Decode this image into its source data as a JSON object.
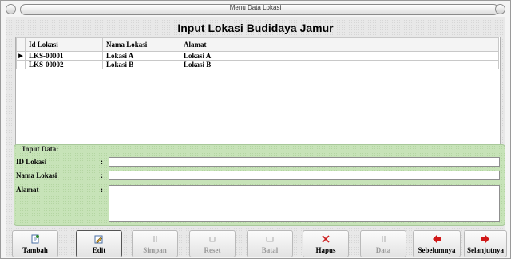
{
  "window": {
    "title": "Menu Data Lokasi"
  },
  "page": {
    "heading": "Input Lokasi Budidaya Jamur"
  },
  "grid": {
    "columns": [
      "Id Lokasi",
      "Nama Lokasi",
      "Alamat"
    ],
    "rows": [
      {
        "id": "LKS-00001",
        "nama": "Lokasi A",
        "alamat": "Lokasi A"
      },
      {
        "id": "LKS-00002",
        "nama": "Lokasi B",
        "alamat": "Lokasi B"
      }
    ],
    "row_indicator": "▶"
  },
  "form": {
    "title": "Input Data:",
    "id_label": "ID Lokasi",
    "nama_label": "Nama Lokasi",
    "alamat_label": "Alamat",
    "colon": ":",
    "id_value": "",
    "nama_value": "",
    "alamat_value": ""
  },
  "toolbar": {
    "tambah": "Tambah",
    "edit": "Edit",
    "simpan": "Simpan",
    "reset": "Reset",
    "batal": "Batal",
    "hapus": "Hapus",
    "data": "Data",
    "sebelumnya": "Sebelumnya",
    "selanjutnya": "Selanjutnya"
  },
  "colors": {
    "form_panel": "#c7e3b8",
    "arrow_red": "#d01818",
    "hapus_red": "#cc1f1f"
  }
}
